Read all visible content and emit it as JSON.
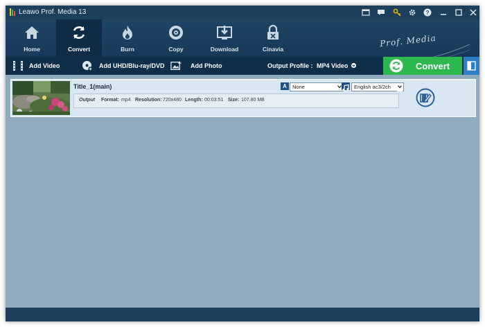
{
  "window": {
    "title": "Leawo Prof. Media 13"
  },
  "titlebar_icons": [
    "shop-icon",
    "chat-icon",
    "key-icon",
    "gear-icon",
    "help-icon",
    "minimize-icon",
    "maximize-icon",
    "close-icon"
  ],
  "nav": {
    "items": [
      {
        "label": "Home",
        "icon": "home-icon"
      },
      {
        "label": "Convert",
        "icon": "convert-icon",
        "active": true
      },
      {
        "label": "Burn",
        "icon": "burn-icon"
      },
      {
        "label": "Copy",
        "icon": "copy-disc-icon"
      },
      {
        "label": "Download",
        "icon": "download-icon"
      },
      {
        "label": "Cinavia",
        "icon": "cinavia-icon"
      }
    ],
    "brand": "Prof. Media"
  },
  "toolbar": {
    "add_video": "Add Video",
    "add_disc": "Add UHD/Blu-ray/DVD",
    "add_photo": "Add Photo",
    "output_profile_label": "Output Profile :",
    "output_profile_value": "MP4 Video",
    "convert": "Convert"
  },
  "items": [
    {
      "title": "Title_1(main)",
      "output_label": "Output",
      "format_key": "Format:",
      "format_val": "mp4",
      "resolution_key": "Resolution:",
      "resolution_val": "720x480",
      "length_key": "Length:",
      "length_val": "00:03:51",
      "size_key": "Size:",
      "size_val": "107.80 MB",
      "subtitle_badge": "A",
      "subtitle_value": "None",
      "audio_value": "English ac3/2ch"
    }
  ],
  "colors": {
    "titlebar": "#1c3f5c",
    "navbar": "#1e4564",
    "toolbar": "#0f2e49",
    "convert_green": "#2db84d",
    "content_bg": "#8eabc0",
    "item_bg": "#d8e7f1"
  }
}
